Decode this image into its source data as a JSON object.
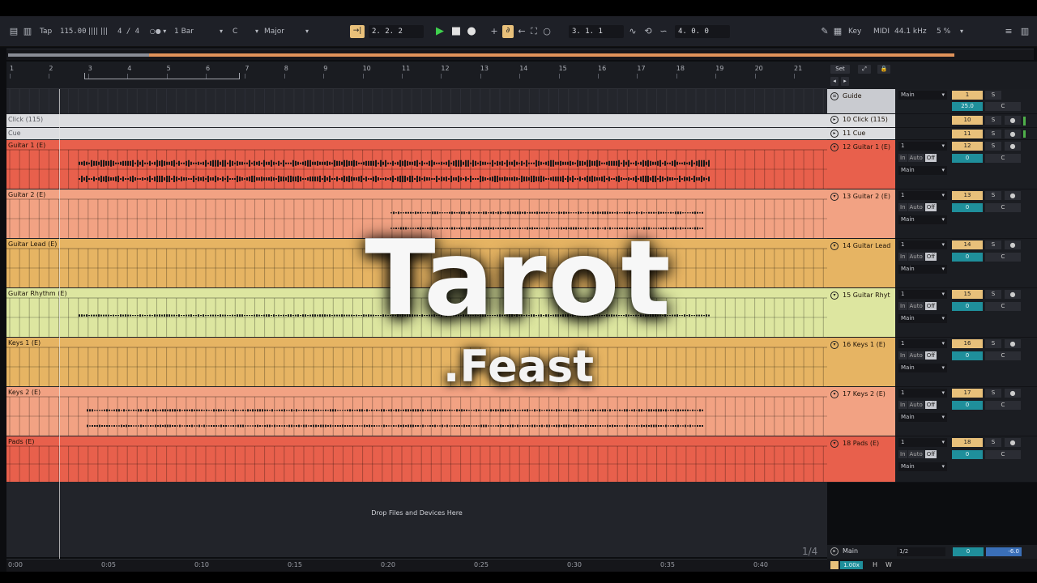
{
  "overlay": {
    "title": "Tarot",
    "artist": ".Feast"
  },
  "toolbar": {
    "tap": "Tap",
    "tempo": "115.00",
    "signature": "4 / 4",
    "quantize": "1 Bar",
    "key_root": "C",
    "scale": "Major",
    "arrangement_position": "2.  2.  2",
    "loop_start": "3.  1.  1",
    "loop_length": "4.  0.  0",
    "key_label": "Key",
    "midi_label": "MIDI",
    "sample_rate": "44.1 kHz",
    "cpu": "5 %"
  },
  "ruler": {
    "bars": [
      "1",
      "2",
      "3",
      "4",
      "5",
      "6",
      "7",
      "8",
      "9",
      "10",
      "11",
      "12",
      "13",
      "14",
      "15",
      "16",
      "17",
      "18",
      "19",
      "20",
      "21"
    ],
    "set_button": "Set"
  },
  "tracks": [
    {
      "lane": "",
      "header": "Guide",
      "color": "#c9cbd0",
      "kind": "guide",
      "output": "Main",
      "num": "1",
      "vol": "25.0",
      "pan": "C"
    },
    {
      "lane": "Click (115)",
      "header": "10 Click (115)",
      "color": "#dcdde0",
      "kind": "click",
      "input": "",
      "num": "10",
      "vol": "",
      "pan": ""
    },
    {
      "lane": "Cue",
      "header": "11 Cue",
      "color": "#dcdde0",
      "kind": "click",
      "input": "",
      "num": "11",
      "vol": "",
      "pan": ""
    },
    {
      "lane": "Guitar 1 (E)",
      "header": "12 Guitar 1 (E)",
      "color": "#e8604c",
      "kind": "audio",
      "input": "1",
      "monitor": [
        "In",
        "Auto",
        "Off"
      ],
      "output": "Main",
      "num": "12",
      "vol": "0",
      "pan": "C"
    },
    {
      "lane": "Guitar 2 (E)",
      "header": "13 Guitar 2 (E)",
      "color": "#f2a283",
      "kind": "audio",
      "input": "1",
      "monitor": [
        "In",
        "Auto",
        "Off"
      ],
      "output": "Main",
      "num": "13",
      "vol": "0",
      "pan": "C"
    },
    {
      "lane": "Guitar Lead (E)",
      "header": "14 Guitar Lead",
      "color": "#e6b463",
      "kind": "audio",
      "input": "1",
      "monitor": [
        "In",
        "Auto",
        "Off"
      ],
      "output": "Main",
      "num": "14",
      "vol": "0",
      "pan": "C"
    },
    {
      "lane": "Guitar Rhythm (E)",
      "header": "15 Guitar Rhyt",
      "color": "#dde6a0",
      "kind": "audio",
      "input": "1",
      "monitor": [
        "In",
        "Auto",
        "Off"
      ],
      "output": "Main",
      "num": "15",
      "vol": "0",
      "pan": "C"
    },
    {
      "lane": "Keys 1 (E)",
      "header": "16 Keys 1 (E)",
      "color": "#e6b463",
      "kind": "audio",
      "input": "1",
      "monitor": [
        "In",
        "Auto",
        "Off"
      ],
      "output": "Main",
      "num": "16",
      "vol": "0",
      "pan": "C"
    },
    {
      "lane": "Keys 2 (E)",
      "header": "17 Keys 2 (E)",
      "color": "#f2a283",
      "kind": "audio",
      "input": "1",
      "monitor": [
        "In",
        "Auto",
        "Off"
      ],
      "output": "Main",
      "num": "17",
      "vol": "0",
      "pan": "C"
    },
    {
      "lane": "Pads (E)",
      "header": "18 Pads (E)",
      "color": "#e8604c",
      "kind": "audio",
      "input": "1",
      "monitor": [
        "In",
        "Auto",
        "Off"
      ],
      "output": "Main",
      "num": "18",
      "vol": "0",
      "pan": "C"
    }
  ],
  "drop_hint": "Drop Files and Devices Here",
  "master": {
    "name": "Main",
    "cue_out": "1/2",
    "vol": "0",
    "level": "-6.0"
  },
  "zoom": {
    "value": "1.00x",
    "h": "H",
    "w": "W"
  },
  "page_indicator": "1/4",
  "timeline": [
    "0:00",
    "0:05",
    "0:10",
    "0:15",
    "0:20",
    "0:25",
    "0:30",
    "0:35",
    "0:40"
  ]
}
